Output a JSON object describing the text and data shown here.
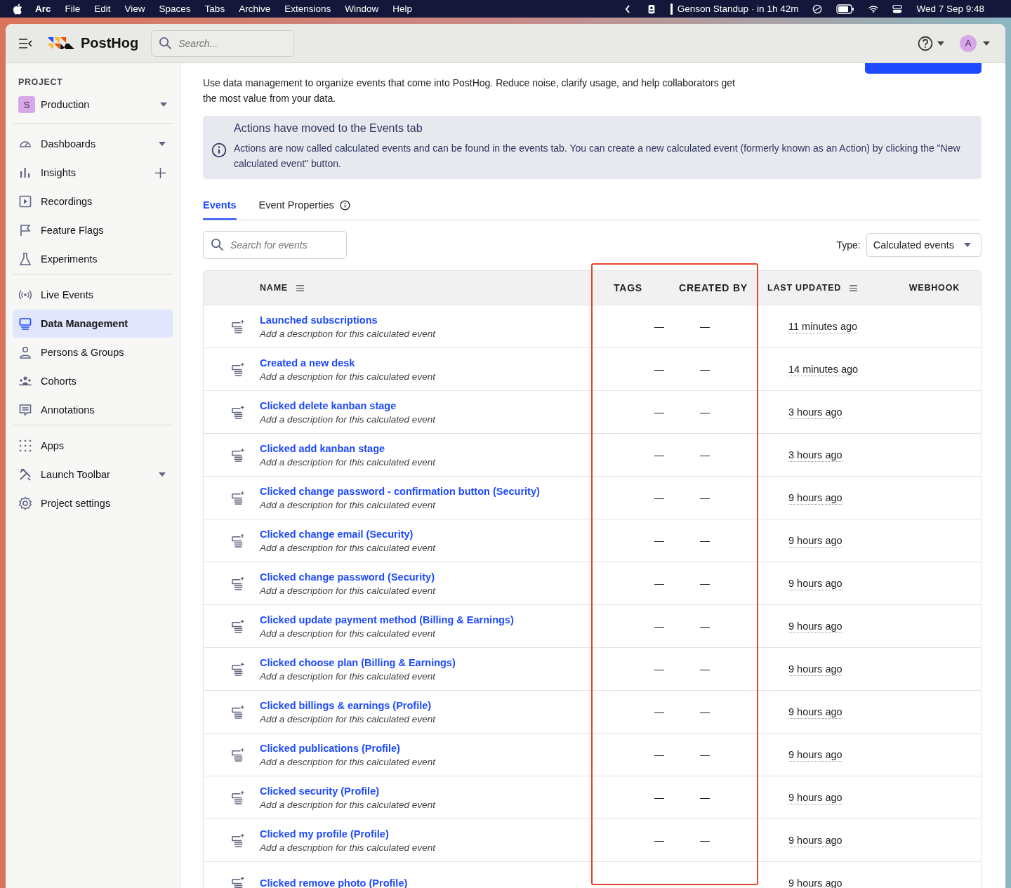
{
  "menu_bar": {
    "app": "Arc",
    "menus": [
      "File",
      "Edit",
      "View",
      "Spaces",
      "Tabs",
      "Archive",
      "Extensions",
      "Window",
      "Help"
    ],
    "event": "Genson Standup · in 1h 42m",
    "clock": "Wed 7 Sep  9:48"
  },
  "header": {
    "brand": "PostHog",
    "search": {
      "placeholder": "Search..."
    },
    "avatar": "A"
  },
  "sidebar": {
    "project_label": "PROJECT",
    "project": {
      "initial": "S",
      "name": "Production"
    },
    "sections": [
      [
        {
          "label": "Dashboards",
          "selected": false,
          "expandable": true
        },
        {
          "label": "Insights",
          "selected": false,
          "addable": true
        },
        {
          "label": "Recordings",
          "selected": false
        },
        {
          "label": "Feature Flags",
          "selected": false
        },
        {
          "label": "Experiments",
          "selected": false
        }
      ],
      [
        {
          "label": "Live Events",
          "selected": false
        },
        {
          "label": "Data Management",
          "selected": true
        },
        {
          "label": "Persons & Groups",
          "selected": false
        },
        {
          "label": "Cohorts",
          "selected": false
        },
        {
          "label": "Annotations",
          "selected": false
        }
      ],
      [
        {
          "label": "Apps",
          "selected": false
        },
        {
          "label": "Launch Toolbar",
          "selected": false,
          "expandable": true
        },
        {
          "label": "Project settings",
          "selected": false
        }
      ]
    ]
  },
  "page": {
    "description": "Use data management to organize events that come into PostHog. Reduce noise, clarify usage, and help collaborators get the most value from your data.",
    "notice": {
      "title": "Actions have moved to the Events tab",
      "body": "Actions are now called calculated events and can be found in the events tab. You can create a new calculated event (formerly known as an Action) by clicking the \"New calculated event\" button."
    },
    "tabs": [
      {
        "label": "Events",
        "selected": true,
        "info": false
      },
      {
        "label": "Event Properties",
        "selected": false,
        "info": true
      }
    ],
    "search": {
      "placeholder": "Search for events"
    },
    "type_filter": {
      "label": "Type:",
      "value": "Calculated events"
    },
    "table": {
      "columns": [
        {
          "label": "NAME",
          "menu": true
        },
        {
          "label": "TAGS",
          "menu": false
        },
        {
          "label": "CREATED BY",
          "menu": false
        },
        {
          "label": "LAST UPDATED",
          "menu": true
        },
        {
          "label": "WEBHOOK",
          "menu": false
        }
      ],
      "rows": [
        {
          "name": "Launched subscriptions",
          "description": "Add a description for this calculated event",
          "tags": "—",
          "created_by": "—",
          "last_updated": "11 minutes ago"
        },
        {
          "name": "Created a new desk",
          "description": "Add a description for this calculated event",
          "tags": "—",
          "created_by": "—",
          "last_updated": "14 minutes ago"
        },
        {
          "name": "Clicked delete kanban stage",
          "description": "Add a description for this calculated event",
          "tags": "—",
          "created_by": "—",
          "last_updated": "3 hours ago"
        },
        {
          "name": "Clicked add kanban stage",
          "description": "Add a description for this calculated event",
          "tags": "—",
          "created_by": "—",
          "last_updated": "3 hours ago"
        },
        {
          "name": "Clicked change password - confirmation button (Security)",
          "description": "Add a description for this calculated event",
          "tags": "—",
          "created_by": "—",
          "last_updated": "9 hours ago"
        },
        {
          "name": "Clicked change email (Security)",
          "description": "Add a description for this calculated event",
          "tags": "—",
          "created_by": "—",
          "last_updated": "9 hours ago"
        },
        {
          "name": "Clicked change password (Security)",
          "description": "Add a description for this calculated event",
          "tags": "—",
          "created_by": "—",
          "last_updated": "9 hours ago"
        },
        {
          "name": "Clicked update payment method (Billing & Earnings)",
          "description": "Add a description for this calculated event",
          "tags": "—",
          "created_by": "—",
          "last_updated": "9 hours ago"
        },
        {
          "name": "Clicked choose plan (Billing & Earnings)",
          "description": "Add a description for this calculated event",
          "tags": "—",
          "created_by": "—",
          "last_updated": "9 hours ago"
        },
        {
          "name": "Clicked billings & earnings (Profile)",
          "description": "Add a description for this calculated event",
          "tags": "—",
          "created_by": "—",
          "last_updated": "9 hours ago"
        },
        {
          "name": "Clicked publications (Profile)",
          "description": "Add a description for this calculated event",
          "tags": "—",
          "created_by": "—",
          "last_updated": "9 hours ago"
        },
        {
          "name": "Clicked security (Profile)",
          "description": "Add a description for this calculated event",
          "tags": "—",
          "created_by": "—",
          "last_updated": "9 hours ago"
        },
        {
          "name": "Clicked my profile (Profile)",
          "description": "Add a description for this calculated event",
          "tags": "—",
          "created_by": "—",
          "last_updated": "9 hours ago"
        },
        {
          "name": "Clicked remove photo (Profile)",
          "last_updated": "9 hours ago"
        }
      ]
    }
  }
}
